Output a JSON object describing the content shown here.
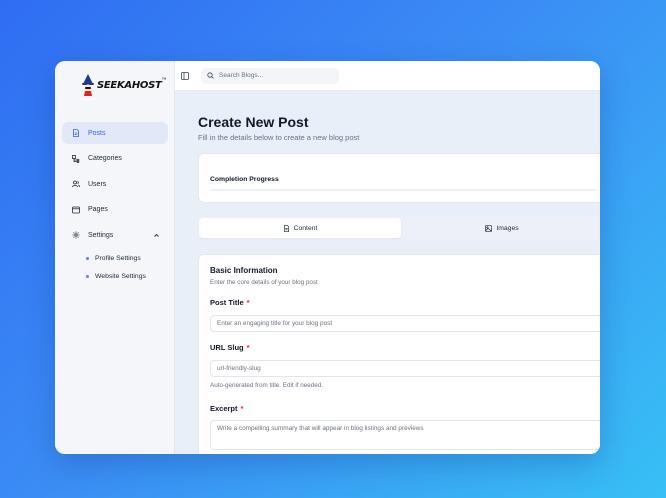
{
  "brand": {
    "logo_text": "SEEKAHOST",
    "trademark": "™"
  },
  "search": {
    "placeholder": "Search Blogs..."
  },
  "sidebar": {
    "items": [
      {
        "label": "Posts",
        "icon": "document-icon",
        "active": true
      },
      {
        "label": "Categories",
        "icon": "category-icon",
        "active": false
      },
      {
        "label": "Users",
        "icon": "users-icon",
        "active": false
      },
      {
        "label": "Pages",
        "icon": "browser-icon",
        "active": false
      },
      {
        "label": "Settings",
        "icon": "gear-icon",
        "active": false,
        "expanded": true
      }
    ],
    "settings_children": [
      {
        "label": "Profile Settings"
      },
      {
        "label": "Website Settings"
      }
    ]
  },
  "main": {
    "title": "Create New Post",
    "subtitle": "Fill in the details below to create a new blog post",
    "progress": {
      "label": "Completion Progress"
    },
    "tabs": [
      {
        "label": "Content",
        "icon": "document-icon",
        "active": true
      },
      {
        "label": "Images",
        "icon": "image-icon",
        "active": false
      }
    ],
    "basic_info": {
      "title": "Basic Information",
      "description": "Enter the core details of your blog post",
      "post_title": {
        "label": "Post Title",
        "required": "*",
        "placeholder": "Enter an engaging title for your blog post"
      },
      "url_slug": {
        "label": "URL Slug",
        "required": "*",
        "placeholder": "url-friendly-slug",
        "helper": "Auto-generated from title. Edit if needed."
      },
      "excerpt": {
        "label": "Excerpt",
        "required": "*",
        "placeholder": "Write a compelling summary that will appear in blog listings and previews"
      }
    }
  },
  "colors": {
    "accent": "#3b5fd6",
    "active_bg": "#e1e9f8",
    "required": "#e11d48",
    "background_gradient_start": "#2f6df2",
    "background_gradient_end": "#38c0f5"
  }
}
